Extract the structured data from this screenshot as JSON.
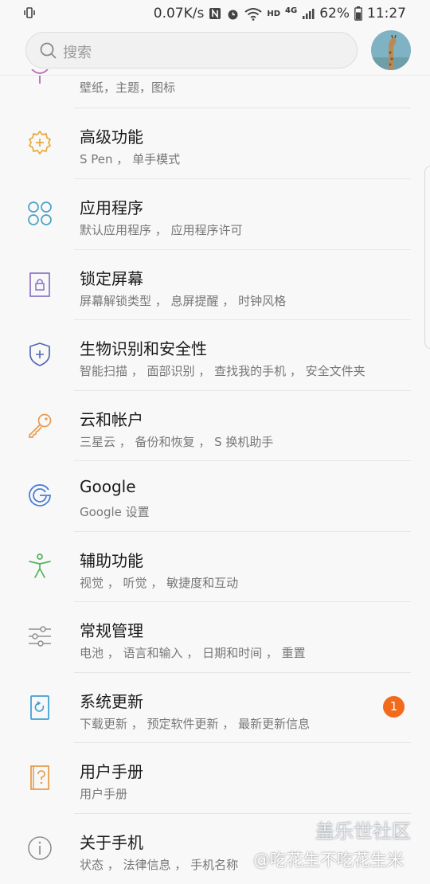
{
  "status_bar": {
    "speed": "0.07K/s",
    "network": "4G",
    "hd": "HD",
    "battery": "62%",
    "time": "11:27"
  },
  "search": {
    "placeholder": "搜索"
  },
  "partial_item": {
    "subtitle": "壁纸，主题，图标"
  },
  "items": [
    {
      "title": "高级功能",
      "subtitle": "S Pen ， 单手模式",
      "icon": "plus-cog-icon",
      "color": "#e8a93a"
    },
    {
      "title": "应用程序",
      "subtitle": "默认应用程序 ， 应用程序许可",
      "icon": "apps-grid-icon",
      "color": "#4aa3c4"
    },
    {
      "title": "锁定屏幕",
      "subtitle": "屏幕解锁类型 ， 息屏提醒 ， 时钟风格",
      "icon": "lock-screen-icon",
      "color": "#8b72c7"
    },
    {
      "title": "生物识别和安全性",
      "subtitle": "智能扫描 ， 面部识别 ， 查找我的手机 ， 安全文件夹",
      "icon": "shield-icon",
      "color": "#5468b0"
    },
    {
      "title": "云和帐户",
      "subtitle": "三星云 ， 备份和恢复 ， S 换机助手",
      "icon": "key-icon",
      "color": "#e79a4e"
    },
    {
      "title": "Google",
      "subtitle": "Google 设置",
      "icon": "google-icon",
      "color": "#4a7fd4"
    },
    {
      "title": "辅助功能",
      "subtitle": "视觉 ， 听觉 ， 敏捷度和互动",
      "icon": "accessibility-icon",
      "color": "#54b25e"
    },
    {
      "title": "常规管理",
      "subtitle": "电池 ， 语言和输入 ， 日期和时间 ， 重置",
      "icon": "sliders-icon",
      "color": "#8f8f8f"
    },
    {
      "title": "系统更新",
      "subtitle": "下载更新 ， 预定软件更新 ， 最新更新信息",
      "icon": "system-update-icon",
      "color": "#3a9ed4",
      "badge": "1"
    },
    {
      "title": "用户手册",
      "subtitle": "用户手册",
      "icon": "user-manual-icon",
      "color": "#e59a45"
    },
    {
      "title": "关于手机",
      "subtitle": "状态 ， 法律信息 ， 手机名称",
      "icon": "info-icon",
      "color": "#8f8f8f"
    }
  ],
  "watermark": {
    "line1": "盖乐世社区",
    "line2": "@吃花生不吃花生米"
  }
}
